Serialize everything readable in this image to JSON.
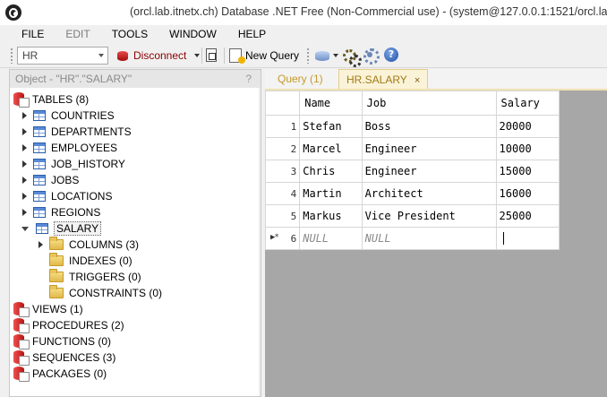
{
  "window": {
    "title": "(orcl.lab.itnetx.ch) Database .NET Free (Non-Commercial use) - (system@127.0.0.1:1521/orcl.lab"
  },
  "menu": [
    {
      "label": "FILE",
      "disabled": false
    },
    {
      "label": "EDIT",
      "disabled": true
    },
    {
      "label": "TOOLS",
      "disabled": false
    },
    {
      "label": "WINDOW",
      "disabled": false
    },
    {
      "label": "HELP",
      "disabled": false
    }
  ],
  "toolbar": {
    "schema_value": "HR",
    "disconnect_label": "Disconnect",
    "new_query_label": "New Query",
    "help_glyph": "?"
  },
  "object_panel": {
    "title": "Object - \"HR\".\"SALARY\"",
    "help": "?",
    "tables_label": "TABLES (8)",
    "tables": [
      "COUNTRIES",
      "DEPARTMENTS",
      "EMPLOYEES",
      "JOB_HISTORY",
      "JOBS",
      "LOCATIONS",
      "REGIONS",
      "SALARY"
    ],
    "salary_children": [
      "COLUMNS (3)",
      "INDEXES (0)",
      "TRIGGERS (0)",
      "CONSTRAINTS (0)"
    ],
    "other_nodes": [
      "VIEWS (1)",
      "PROCEDURES (2)",
      "FUNCTIONS (0)",
      "SEQUENCES (3)",
      "PACKAGES (0)"
    ]
  },
  "tabs": {
    "query": "Query (1)",
    "salary": "HR.SALARY",
    "close": "×"
  },
  "grid": {
    "columns": [
      "Name",
      "Job",
      "Salary"
    ],
    "rows": [
      {
        "num": "1",
        "name": "Stefan",
        "job": "Boss",
        "salary": "20000"
      },
      {
        "num": "2",
        "name": "Marcel",
        "job": "Engineer",
        "salary": "10000"
      },
      {
        "num": "3",
        "name": "Chris",
        "job": "Engineer",
        "salary": "15000"
      },
      {
        "num": "4",
        "name": "Martin",
        "job": "Architect",
        "salary": "16000"
      },
      {
        "num": "5",
        "name": "Markus",
        "job": "Vice President",
        "salary": "25000"
      }
    ],
    "new_row": {
      "marker": "▶*",
      "num": "6",
      "name": "NULL",
      "job": "NULL"
    }
  },
  "colors": {
    "accent_tab": "#fbf3d8",
    "disconnect_text": "#8a0000",
    "grid_bg": "#a7a7a7"
  }
}
